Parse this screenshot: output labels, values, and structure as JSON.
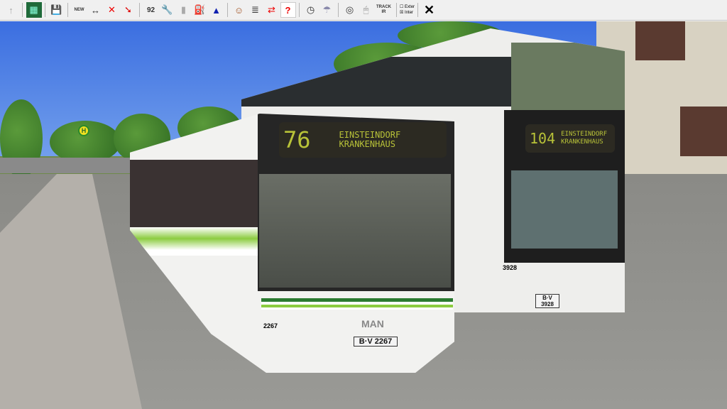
{
  "toolbar": {
    "items": [
      {
        "name": "up-arrow",
        "label": "↑"
      },
      {
        "name": "map",
        "label": "▦"
      },
      {
        "name": "save",
        "label": "💾"
      },
      {
        "name": "new-bus",
        "label": "NEW"
      },
      {
        "name": "move-bus",
        "label": "↔"
      },
      {
        "name": "delete-bus",
        "label": "✕"
      },
      {
        "name": "pointer",
        "label": "➘"
      },
      {
        "name": "timetable",
        "label": "92"
      },
      {
        "name": "repair",
        "label": "🔧"
      },
      {
        "name": "bus-grey",
        "label": "▮"
      },
      {
        "name": "fuel",
        "label": "⛽"
      },
      {
        "name": "bell",
        "label": "▲"
      },
      {
        "name": "driver",
        "label": "☺"
      },
      {
        "name": "document",
        "label": "≣"
      },
      {
        "name": "swap-driver",
        "label": "⇄"
      },
      {
        "name": "help",
        "label": "?"
      },
      {
        "name": "clock",
        "label": "◷"
      },
      {
        "name": "weather",
        "label": "☂"
      },
      {
        "name": "steering-wheel",
        "label": "◎"
      },
      {
        "name": "mouse",
        "label": "🖱"
      },
      {
        "name": "trackir",
        "label": "TRACK IR"
      },
      {
        "name": "close",
        "label": "✕"
      }
    ],
    "camera_options": [
      "Exter",
      "Inter"
    ]
  },
  "scene": {
    "bus_stop_sign": "H",
    "bus1": {
      "route": "76",
      "dest_line1": "EINSTEINDORF",
      "dest_line2": "KRANKENHAUS",
      "fleet_number": "2267",
      "plate": "B·V 2267",
      "brand": "MAN"
    },
    "bus2": {
      "route": "104",
      "dest_line1": "EINSTEINDORF",
      "dest_line2": "KRANKENHAUS",
      "fleet_number": "3928",
      "plate": "B·V 3928"
    }
  }
}
